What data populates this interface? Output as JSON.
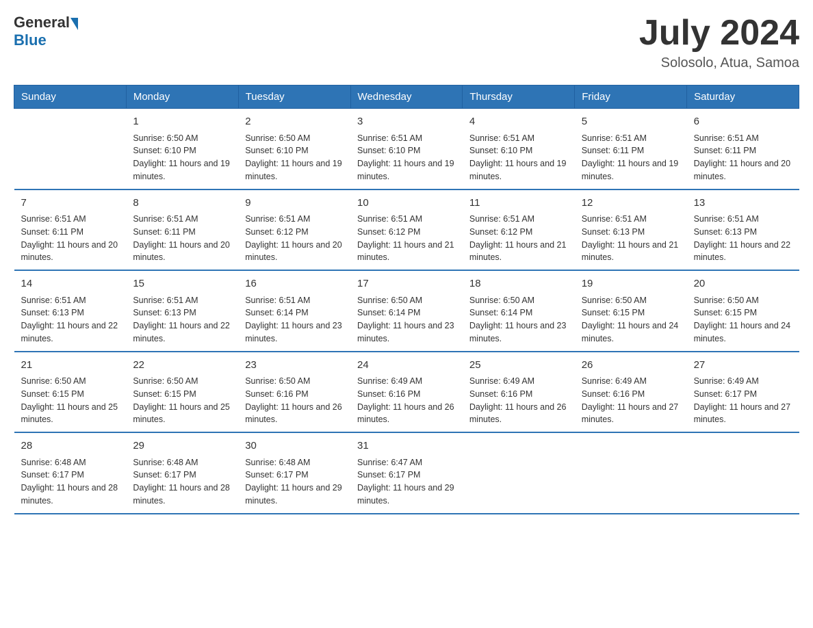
{
  "header": {
    "logo_general": "General",
    "logo_blue": "Blue",
    "month_year": "July 2024",
    "location": "Solosolo, Atua, Samoa"
  },
  "days_of_week": [
    "Sunday",
    "Monday",
    "Tuesday",
    "Wednesday",
    "Thursday",
    "Friday",
    "Saturday"
  ],
  "weeks": [
    [
      {
        "day": "",
        "sunrise": "",
        "sunset": "",
        "daylight": ""
      },
      {
        "day": "1",
        "sunrise": "Sunrise: 6:50 AM",
        "sunset": "Sunset: 6:10 PM",
        "daylight": "Daylight: 11 hours and 19 minutes."
      },
      {
        "day": "2",
        "sunrise": "Sunrise: 6:50 AM",
        "sunset": "Sunset: 6:10 PM",
        "daylight": "Daylight: 11 hours and 19 minutes."
      },
      {
        "day": "3",
        "sunrise": "Sunrise: 6:51 AM",
        "sunset": "Sunset: 6:10 PM",
        "daylight": "Daylight: 11 hours and 19 minutes."
      },
      {
        "day": "4",
        "sunrise": "Sunrise: 6:51 AM",
        "sunset": "Sunset: 6:10 PM",
        "daylight": "Daylight: 11 hours and 19 minutes."
      },
      {
        "day": "5",
        "sunrise": "Sunrise: 6:51 AM",
        "sunset": "Sunset: 6:11 PM",
        "daylight": "Daylight: 11 hours and 19 minutes."
      },
      {
        "day": "6",
        "sunrise": "Sunrise: 6:51 AM",
        "sunset": "Sunset: 6:11 PM",
        "daylight": "Daylight: 11 hours and 20 minutes."
      }
    ],
    [
      {
        "day": "7",
        "sunrise": "Sunrise: 6:51 AM",
        "sunset": "Sunset: 6:11 PM",
        "daylight": "Daylight: 11 hours and 20 minutes."
      },
      {
        "day": "8",
        "sunrise": "Sunrise: 6:51 AM",
        "sunset": "Sunset: 6:11 PM",
        "daylight": "Daylight: 11 hours and 20 minutes."
      },
      {
        "day": "9",
        "sunrise": "Sunrise: 6:51 AM",
        "sunset": "Sunset: 6:12 PM",
        "daylight": "Daylight: 11 hours and 20 minutes."
      },
      {
        "day": "10",
        "sunrise": "Sunrise: 6:51 AM",
        "sunset": "Sunset: 6:12 PM",
        "daylight": "Daylight: 11 hours and 21 minutes."
      },
      {
        "day": "11",
        "sunrise": "Sunrise: 6:51 AM",
        "sunset": "Sunset: 6:12 PM",
        "daylight": "Daylight: 11 hours and 21 minutes."
      },
      {
        "day": "12",
        "sunrise": "Sunrise: 6:51 AM",
        "sunset": "Sunset: 6:13 PM",
        "daylight": "Daylight: 11 hours and 21 minutes."
      },
      {
        "day": "13",
        "sunrise": "Sunrise: 6:51 AM",
        "sunset": "Sunset: 6:13 PM",
        "daylight": "Daylight: 11 hours and 22 minutes."
      }
    ],
    [
      {
        "day": "14",
        "sunrise": "Sunrise: 6:51 AM",
        "sunset": "Sunset: 6:13 PM",
        "daylight": "Daylight: 11 hours and 22 minutes."
      },
      {
        "day": "15",
        "sunrise": "Sunrise: 6:51 AM",
        "sunset": "Sunset: 6:13 PM",
        "daylight": "Daylight: 11 hours and 22 minutes."
      },
      {
        "day": "16",
        "sunrise": "Sunrise: 6:51 AM",
        "sunset": "Sunset: 6:14 PM",
        "daylight": "Daylight: 11 hours and 23 minutes."
      },
      {
        "day": "17",
        "sunrise": "Sunrise: 6:50 AM",
        "sunset": "Sunset: 6:14 PM",
        "daylight": "Daylight: 11 hours and 23 minutes."
      },
      {
        "day": "18",
        "sunrise": "Sunrise: 6:50 AM",
        "sunset": "Sunset: 6:14 PM",
        "daylight": "Daylight: 11 hours and 23 minutes."
      },
      {
        "day": "19",
        "sunrise": "Sunrise: 6:50 AM",
        "sunset": "Sunset: 6:15 PM",
        "daylight": "Daylight: 11 hours and 24 minutes."
      },
      {
        "day": "20",
        "sunrise": "Sunrise: 6:50 AM",
        "sunset": "Sunset: 6:15 PM",
        "daylight": "Daylight: 11 hours and 24 minutes."
      }
    ],
    [
      {
        "day": "21",
        "sunrise": "Sunrise: 6:50 AM",
        "sunset": "Sunset: 6:15 PM",
        "daylight": "Daylight: 11 hours and 25 minutes."
      },
      {
        "day": "22",
        "sunrise": "Sunrise: 6:50 AM",
        "sunset": "Sunset: 6:15 PM",
        "daylight": "Daylight: 11 hours and 25 minutes."
      },
      {
        "day": "23",
        "sunrise": "Sunrise: 6:50 AM",
        "sunset": "Sunset: 6:16 PM",
        "daylight": "Daylight: 11 hours and 26 minutes."
      },
      {
        "day": "24",
        "sunrise": "Sunrise: 6:49 AM",
        "sunset": "Sunset: 6:16 PM",
        "daylight": "Daylight: 11 hours and 26 minutes."
      },
      {
        "day": "25",
        "sunrise": "Sunrise: 6:49 AM",
        "sunset": "Sunset: 6:16 PM",
        "daylight": "Daylight: 11 hours and 26 minutes."
      },
      {
        "day": "26",
        "sunrise": "Sunrise: 6:49 AM",
        "sunset": "Sunset: 6:16 PM",
        "daylight": "Daylight: 11 hours and 27 minutes."
      },
      {
        "day": "27",
        "sunrise": "Sunrise: 6:49 AM",
        "sunset": "Sunset: 6:17 PM",
        "daylight": "Daylight: 11 hours and 27 minutes."
      }
    ],
    [
      {
        "day": "28",
        "sunrise": "Sunrise: 6:48 AM",
        "sunset": "Sunset: 6:17 PM",
        "daylight": "Daylight: 11 hours and 28 minutes."
      },
      {
        "day": "29",
        "sunrise": "Sunrise: 6:48 AM",
        "sunset": "Sunset: 6:17 PM",
        "daylight": "Daylight: 11 hours and 28 minutes."
      },
      {
        "day": "30",
        "sunrise": "Sunrise: 6:48 AM",
        "sunset": "Sunset: 6:17 PM",
        "daylight": "Daylight: 11 hours and 29 minutes."
      },
      {
        "day": "31",
        "sunrise": "Sunrise: 6:47 AM",
        "sunset": "Sunset: 6:17 PM",
        "daylight": "Daylight: 11 hours and 29 minutes."
      },
      {
        "day": "",
        "sunrise": "",
        "sunset": "",
        "daylight": ""
      },
      {
        "day": "",
        "sunrise": "",
        "sunset": "",
        "daylight": ""
      },
      {
        "day": "",
        "sunrise": "",
        "sunset": "",
        "daylight": ""
      }
    ]
  ]
}
